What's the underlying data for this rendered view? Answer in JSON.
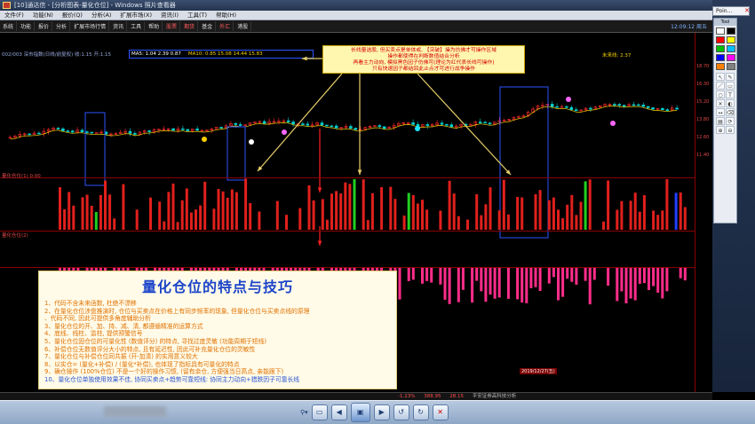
{
  "window": {
    "title": "[10]通达信 - [分析图表-量化仓位] - Windows 照片查看器"
  },
  "menu": {
    "items": [
      "文件(F)",
      "功能(N)",
      "报价(Q)",
      "分析(A)",
      "扩展市场(X)",
      "资讯(I)",
      "工具(T)",
      "帮助(H)"
    ]
  },
  "toolbar": {
    "items": [
      "系统",
      "功能",
      "报价",
      "分析",
      "扩展市场行情",
      "资讯",
      "工具",
      "帮助",
      "股票",
      "期货",
      "基金",
      "外汇",
      "港股"
    ],
    "red_items": [
      "股票",
      "期货",
      "外汇"
    ],
    "clock": "12:09:12 周五"
  },
  "chart": {
    "info_line": "002/003 深市指数(日线/前复权) 收:1.15 开:1.15",
    "ma_labels": [
      "MA5: 1.04 2.39 0.87",
      "MA10: 0.85 15.08 14.44 15.83"
    ],
    "right_label": "未来线: 2.37",
    "sub1_label": "量化仓位(1) 0.00",
    "sub2_label": "量化仓位(2)",
    "axis_ticks": [
      "18.70",
      "16.30",
      "15.20",
      "13.80",
      "12.60",
      "11.40"
    ],
    "bottom_date": "2019/12/27(五)",
    "colors": {
      "up": "#ff2a2a",
      "down": "#00d0d0",
      "bar_magenta": "#ff2d8a",
      "frame": "#2d55ff",
      "arrow": "#e8d06a",
      "red_arrow": "#ff2020"
    }
  },
  "callout": {
    "lines": [
      "长线量选股, 但买卖点是单体或, 【突破】操为仿佛才可操作区域",
      "操作都使得在判断数值结合分析",
      "再看主力动向, 模拟黑色因子仿佛可(理论为红代表长线可操作)",
      "只有快速因子都结回此止点才可进行战争操作"
    ]
  },
  "panel": {
    "title": "量化仓位的特点与技巧",
    "lines": [
      "1、代码不含未来函数, 杜绝不漂移",
      "2、在量化仓位涉盘推演时, 仓位与买卖点在价格上有同步频率的现象, 但量化仓位与买卖点线的原理",
      "、代码不同, 因此可提供多角度辅助分析",
      "3、量化仓位的开、加、持、减、清, 都遵循精准的运算方式",
      "4、底线、线柱、监柱, 提供预警信号",
      "5、量化仓位固仓位的可量化性 (数值评分) 的特点, 寻找过度灵敏 (功能周期于短线)",
      "6、补偿仓位无数值评分大小的特点, 且有延迟性, 因此可补充量化仓位的灵敏性",
      "7、量化仓位与补偿仓位同共振 (开-加清) 的实用意义较大",
      "8、以实仓= (量化+补偿) / (量化*补偿), 也体现了指标具有可量化的特点",
      "9、确仓操作 (100%仓位) 不是一个好的操作习惯, (留有余仓, 方便强当日高点, 亲能跟下)",
      "10、量化仓位单独使用效果不佳, 协同买卖点+趋势可靠短线: 协同主力动向+猎跌因子可靠长线"
    ]
  },
  "side": {
    "tab_label": "Poin..."
  },
  "toolbox": {
    "title": "Tool",
    "swatch_colors": [
      "#ffffff",
      "#000000",
      "#ff0000",
      "#ffff00",
      "#00c000",
      "#00c0ff",
      "#0000ff",
      "#ff00ff",
      "#ff8000",
      "#808080"
    ],
    "tools": [
      "↖",
      "✎",
      "／",
      "▭",
      "○",
      "T",
      "✕",
      "◐",
      "↔",
      "⌫",
      "▤",
      "⟳",
      "⊕",
      "⊖"
    ]
  },
  "status": {
    "red_items": [
      "-1.23%",
      "388.95",
      "28.15"
    ],
    "text": "平安证券高科技分析"
  },
  "viewer": {
    "zoom_icon": "zoom-icon",
    "buttons": [
      "prev",
      "slideshow",
      "next",
      "rotate-left",
      "rotate-right",
      "delete"
    ]
  }
}
